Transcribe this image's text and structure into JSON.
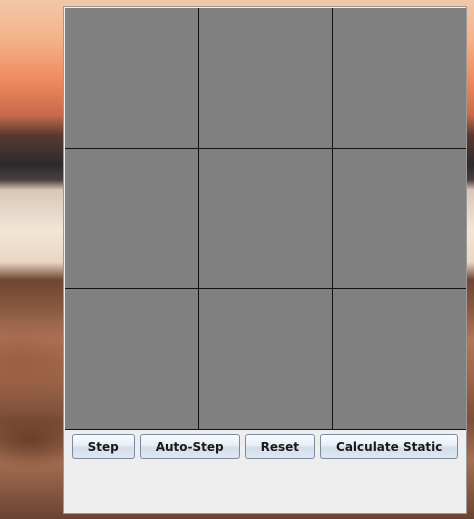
{
  "grid": {
    "rows": 3,
    "columns": 3,
    "cell_color": "#808080",
    "line_color": "#111111"
  },
  "buttons": {
    "step": "Step",
    "auto_step": "Auto-Step",
    "reset": "Reset",
    "calculate_static": "Calculate Static"
  },
  "colors": {
    "window_background": "#eeeeee",
    "button_text": "#1a1a1a"
  }
}
